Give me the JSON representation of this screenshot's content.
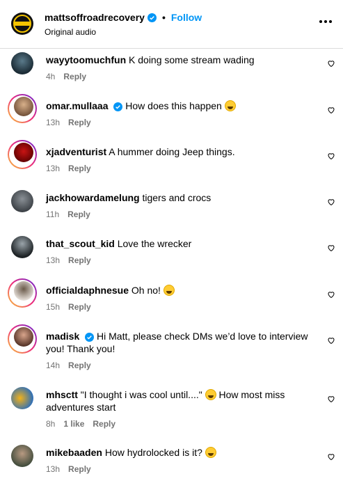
{
  "header": {
    "username": "mattsoffroadrecovery",
    "separator": "•",
    "follow_label": "Follow",
    "subtitle": "Original audio"
  },
  "comments": [
    {
      "username": "wayytoomuchfun",
      "text": "K doing some stream wading",
      "time": "4h",
      "reply": "Reply",
      "verified": false,
      "emoji": false
    },
    {
      "username": "omar.mullaaa",
      "text": "How does this happen",
      "time": "13h",
      "reply": "Reply",
      "verified": true,
      "emoji": true
    },
    {
      "username": "xjadventurist",
      "text": "A hummer doing Jeep things.",
      "time": "13h",
      "reply": "Reply",
      "verified": false,
      "emoji": false
    },
    {
      "username": "jackhowardamelung",
      "text": "tigers and crocs",
      "time": "11h",
      "reply": "Reply",
      "verified": false,
      "emoji": false
    },
    {
      "username": "that_scout_kid",
      "text": "Love the wrecker",
      "time": "13h",
      "reply": "Reply",
      "verified": false,
      "emoji": false
    },
    {
      "username": "officialdaphnesue",
      "text": "Oh no!",
      "time": "15h",
      "reply": "Reply",
      "verified": false,
      "emoji": true
    },
    {
      "username": "madisk",
      "text": "Hi Matt, please check DMs we’d love to interview you! Thank you!",
      "time": "14h",
      "reply": "Reply",
      "verified": true,
      "emoji": false
    },
    {
      "username": "mhsctt",
      "text_before": "\"I thought i was cool until....\"",
      "text_after": "How most miss adventures start",
      "time": "8h",
      "likes": "1 like",
      "reply": "Reply",
      "verified": false,
      "emoji": true
    },
    {
      "username": "mikebaaden",
      "text": "How hydrolocked is it?",
      "time": "13h",
      "reply": "Reply",
      "verified": false,
      "emoji": true
    }
  ],
  "icons": {
    "verified": "verified-badge-icon",
    "heart": "heart-outline-icon",
    "more": "more-options-icon"
  },
  "colors": {
    "follow": "#0095f6",
    "verified": "#0095f6",
    "meta": "#737373"
  }
}
